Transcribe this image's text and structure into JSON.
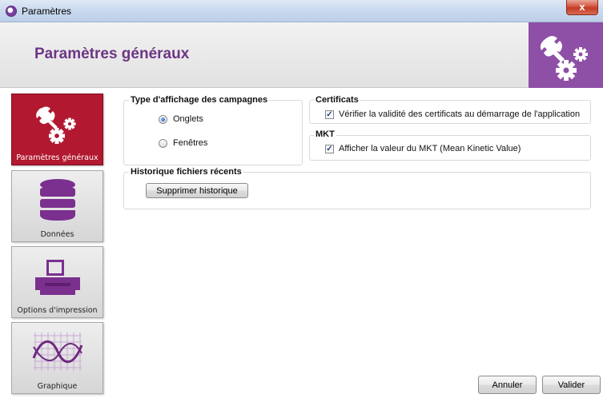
{
  "window": {
    "title": "Paramètres",
    "close_glyph": "x"
  },
  "header": {
    "title": "Paramètres généraux",
    "logo_icon": "tool-gears-icon",
    "logo_color": "#8e4fa6"
  },
  "sidebar": {
    "items": [
      {
        "label": "Paramètres généraux",
        "icon": "tool-gears-icon",
        "active": true
      },
      {
        "label": "Données",
        "icon": "database-icon",
        "active": false
      },
      {
        "label": "Options d'impression",
        "icon": "printer-icon",
        "active": false
      },
      {
        "label": "Graphique",
        "icon": "chart-curve-icon",
        "active": false
      }
    ]
  },
  "display_type": {
    "title": "Type d'affichage des campagnes",
    "options": [
      {
        "label": "Onglets",
        "selected": true
      },
      {
        "label": "Fenêtres",
        "selected": false
      }
    ]
  },
  "certificates": {
    "title": "Certificats",
    "checkbox_label": "Vérifier la validité des certificats au démarrage de l'application",
    "checked": true
  },
  "mkt": {
    "title": "MKT",
    "checkbox_label": "Afficher la valeur du MKT (Mean Kinetic Value)",
    "checked": true
  },
  "history": {
    "title": "Historique fichiers récents",
    "clear_button": "Supprimer historique"
  },
  "footer": {
    "cancel": "Annuler",
    "validate": "Valider"
  },
  "colors": {
    "accent_purple": "#6d3584",
    "active_red": "#b2182f",
    "database_purple": "#7b2f8f"
  }
}
